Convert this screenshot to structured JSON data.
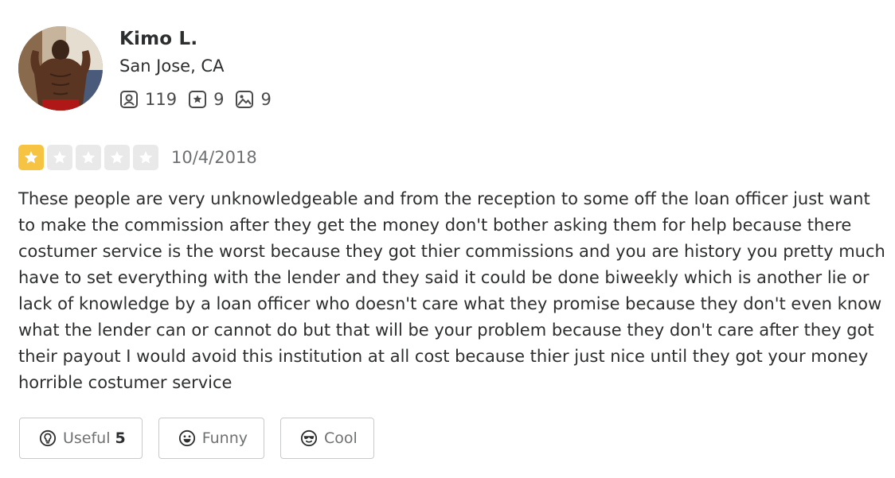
{
  "user": {
    "name": "Kimo L.",
    "location": "San Jose, CA",
    "stats": {
      "friends": "119",
      "reviews": "9",
      "photos": "9"
    }
  },
  "review": {
    "rating": 1,
    "max_rating": 5,
    "date": "10/4/2018",
    "text": "These people are very unknowledgeable and from the reception to some off the loan officer just want to make the commission after they get the money don't bother asking them for help because there costumer service is the worst because they got thier commissions and you are history you pretty much have to set everything with the lender and they said it could be done biweekly which is another lie or lack of knowledge by a loan officer who doesn't care what they promise because they don't even know what the lender can or cannot do but that will be your problem because they don't care after they got their payout I would avoid this institution at all cost because thier just nice until they got your money horrible costumer service"
  },
  "reactions": {
    "useful_label": "Useful",
    "useful_count": "5",
    "funny_label": "Funny",
    "cool_label": "Cool"
  },
  "colors": {
    "star_filled": "#f6c342",
    "star_empty": "#e9e9e9",
    "text": "#2d2e2f",
    "muted": "#6e7072"
  }
}
